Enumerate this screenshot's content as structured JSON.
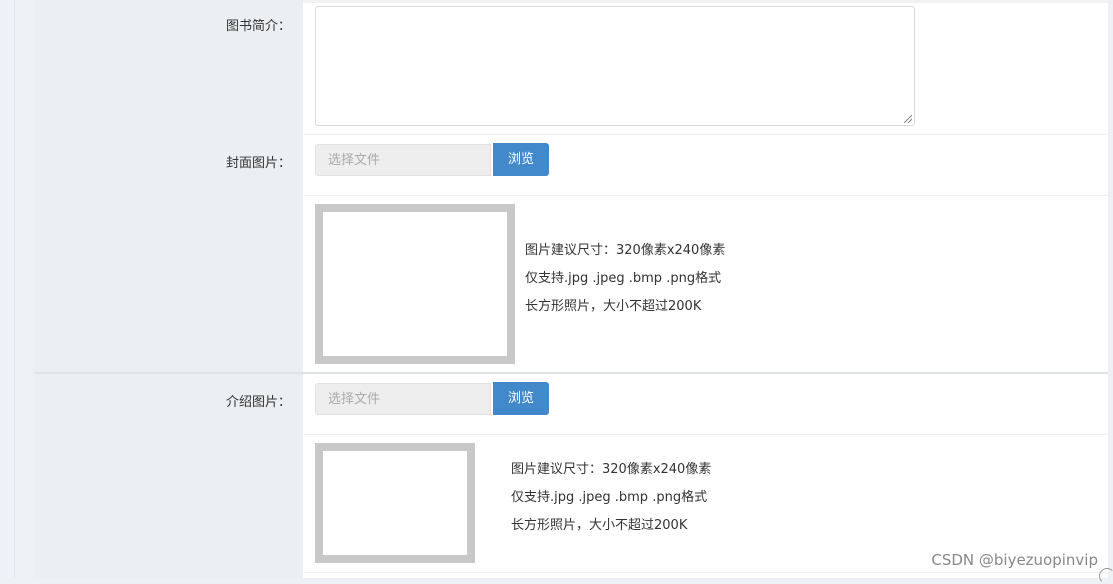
{
  "form": {
    "intro_label": "图书简介：",
    "cover_label": "封面图片：",
    "cover_file_placeholder": "选择文件",
    "cover_browse": "浏览",
    "cover_hints": [
      "图片建议尺寸：320像素x240像素",
      "仅支持.jpg .jpeg .bmp .png格式",
      "长方形照片，大小不超过200K"
    ],
    "detail_label": "介绍图片：",
    "detail_file_placeholder": "选择文件",
    "detail_browse": "浏览",
    "detail_hints": [
      "图片建议尺寸：320像素x240像素",
      "仅支持.jpg .jpeg .bmp .png格式",
      "长方形照片，大小不超过200K"
    ]
  },
  "watermark": "CSDN @biyezuopinvip"
}
